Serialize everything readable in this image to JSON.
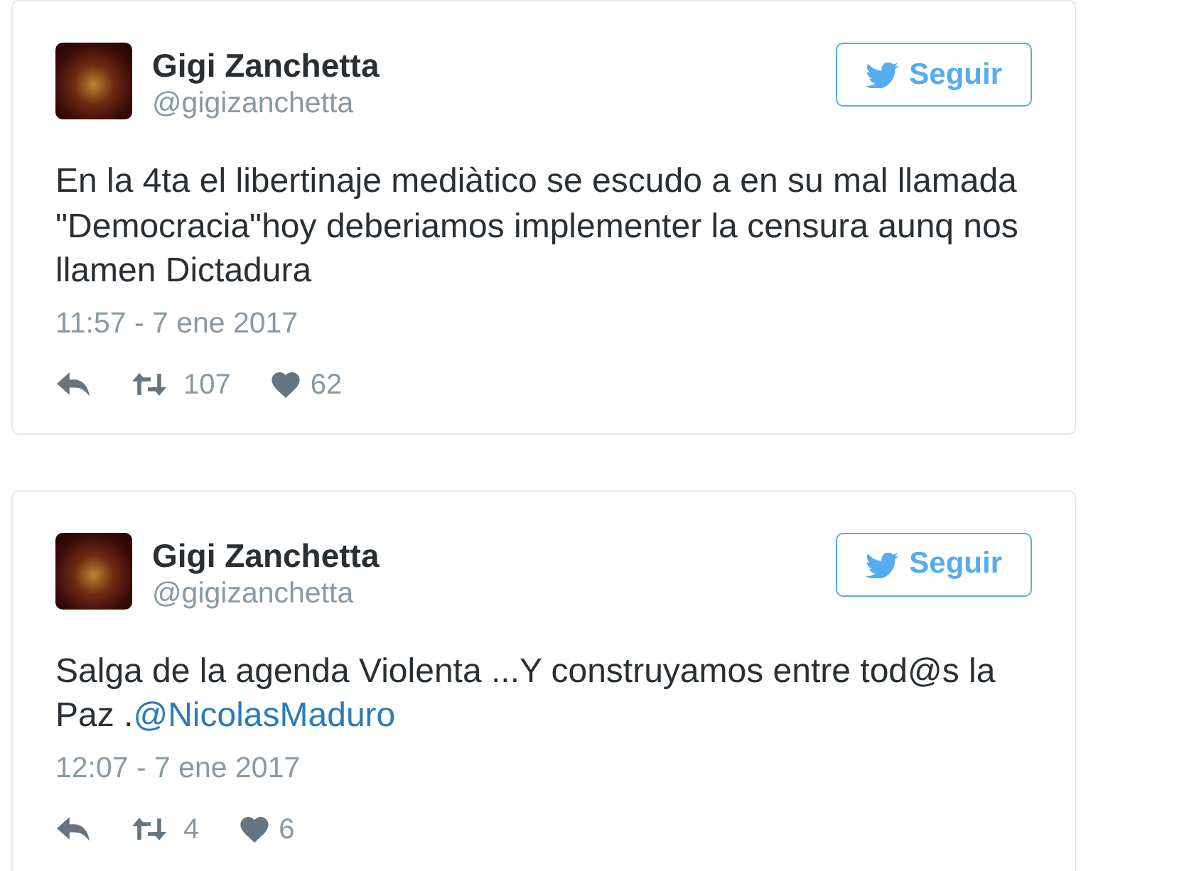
{
  "tweets": [
    {
      "author": {
        "name": "Gigi Zanchetta",
        "handle": "@gigizanchetta"
      },
      "follow_button": {
        "label": "Seguir"
      },
      "text": [
        {
          "kind": "plain",
          "text": "En la 4ta el libertinaje mediàtico se escudo a en su mal llamada \"Democracia\"hoy deberiamos implementer la censura aunq nos llamen Dictadura"
        }
      ],
      "timestamp": "11:57 - 7 ene 2017",
      "retweets": "107",
      "likes": "62"
    },
    {
      "author": {
        "name": "Gigi Zanchetta",
        "handle": "@gigizanchetta"
      },
      "follow_button": {
        "label": "Seguir"
      },
      "text": [
        {
          "kind": "plain",
          "text": "Salga de la agenda Violenta ...Y construyamos entre tod@s la Paz ."
        },
        {
          "kind": "mention",
          "text": "@NicolasMaduro"
        }
      ],
      "timestamp": "12:07 - 7 ene 2017",
      "retweets": "4",
      "likes": "6"
    }
  ]
}
